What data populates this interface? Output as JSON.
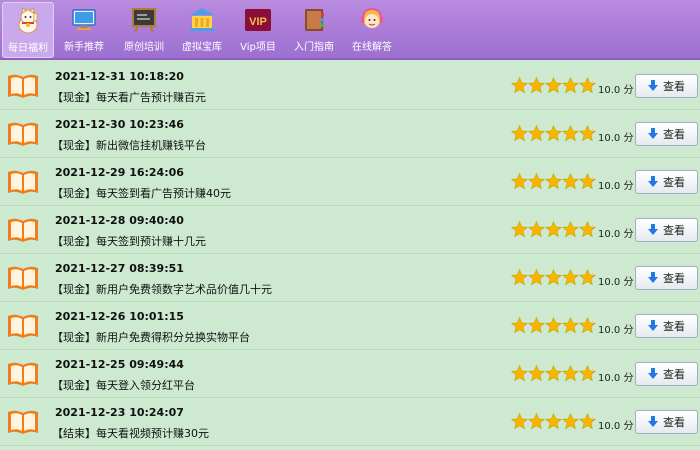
{
  "nav": {
    "tabs": [
      {
        "label": "每日福利",
        "icon": "lucky-cat-icon",
        "active": true
      },
      {
        "label": "新手推荐",
        "icon": "computer-icon",
        "active": false
      },
      {
        "label": "原创培训",
        "icon": "blackboard-icon",
        "active": false
      },
      {
        "label": "虚拟宝库",
        "icon": "bank-icon",
        "active": false
      },
      {
        "label": "Vip项目",
        "icon": "vip-icon",
        "active": false
      },
      {
        "label": "入门指南",
        "icon": "guide-book-icon",
        "active": false
      },
      {
        "label": "在线解答",
        "icon": "support-agent-icon",
        "active": false
      }
    ]
  },
  "items": [
    {
      "time": "2021-12-31 10:18:20",
      "title": "【现金】每天看广告预计赚百元",
      "score": "10.0 分",
      "rating": 5
    },
    {
      "time": "2021-12-30 10:23:46",
      "title": "【现金】新出微信挂机赚钱平台",
      "score": "10.0 分",
      "rating": 5
    },
    {
      "time": "2021-12-29 16:24:06",
      "title": "【现金】每天签到看广告预计赚40元",
      "score": "10.0 分",
      "rating": 5
    },
    {
      "time": "2021-12-28 09:40:40",
      "title": "【现金】每天签到预计赚十几元",
      "score": "10.0 分",
      "rating": 5
    },
    {
      "time": "2021-12-27 08:39:51",
      "title": "【现金】新用户免费领数字艺术品价值几十元",
      "score": "10.0 分",
      "rating": 5
    },
    {
      "time": "2021-12-26 10:01:15",
      "title": "【现金】新用户免费得积分兑换实物平台",
      "score": "10.0 分",
      "rating": 5
    },
    {
      "time": "2021-12-25 09:49:44",
      "title": "【现金】每天登入领分红平台",
      "score": "10.0 分",
      "rating": 5
    },
    {
      "time": "2021-12-23 10:24:07",
      "title": "【结束】每天看视频预计赚30元",
      "score": "10.0 分",
      "rating": 5
    }
  ],
  "view_button_label": "查看",
  "colors": {
    "star": "#f5b800",
    "toolbar": "#a778d8",
    "background": "#cde9cf",
    "book": "#f07c1e"
  }
}
